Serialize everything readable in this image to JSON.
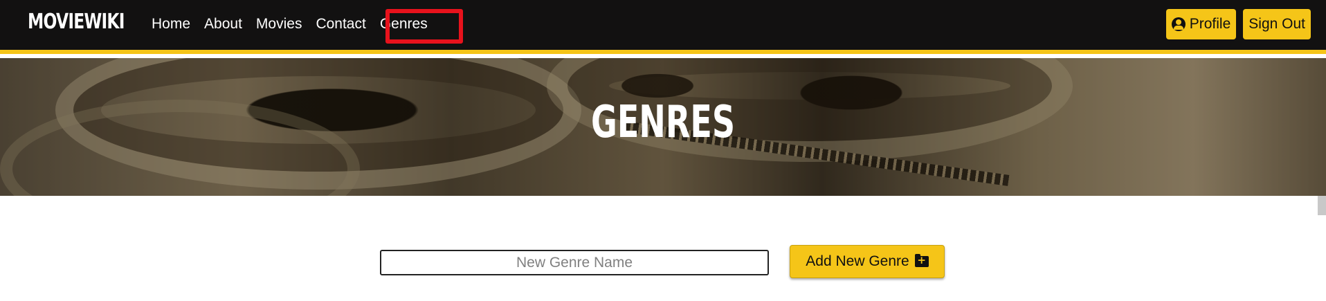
{
  "navbar": {
    "brand": "MOVIEWIKI",
    "links": [
      {
        "label": "Home"
      },
      {
        "label": "About"
      },
      {
        "label": "Movies"
      },
      {
        "label": "Contact"
      },
      {
        "label": "Genres"
      }
    ],
    "profile_label": "Profile",
    "signout_label": "Sign Out"
  },
  "hero": {
    "title": "GENRES"
  },
  "form": {
    "input_placeholder": "New Genre Name",
    "input_value": "",
    "add_button_label": "Add New Genre"
  },
  "icons": {
    "profile": "user-circle-icon",
    "add_folder": "folder-plus-icon"
  },
  "colors": {
    "navbar_bg": "#121111",
    "accent": "#f5c518",
    "annotation": "#e8121c"
  }
}
